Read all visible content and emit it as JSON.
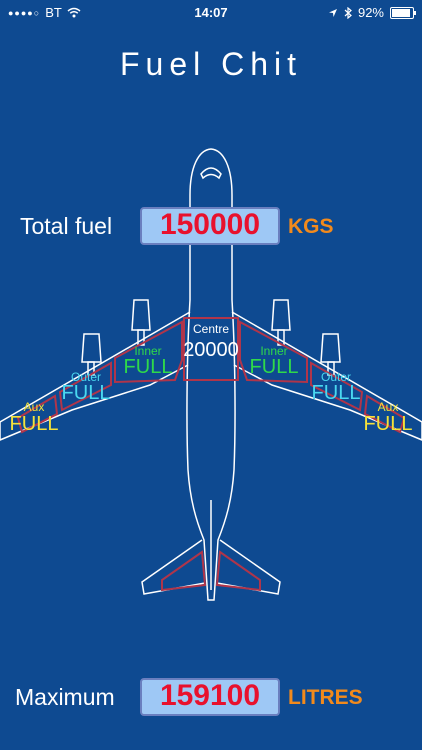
{
  "status": {
    "carrier": "BT",
    "time": "14:07",
    "battery": "92%"
  },
  "title": "Fuel Chit",
  "total": {
    "label": "Total fuel",
    "value": "150000",
    "unit": "KGS"
  },
  "maximum": {
    "label": "Maximum",
    "value": "159100",
    "unit": "LITRES"
  },
  "tanks": {
    "centre": {
      "label": "Centre",
      "value": "20000"
    },
    "inner_left": {
      "label": "Inner",
      "value": "FULL"
    },
    "inner_right": {
      "label": "Inner",
      "value": "FULL"
    },
    "outer_left": {
      "label": "Outer",
      "value": "FULL"
    },
    "outer_right": {
      "label": "Outer",
      "value": "FULL"
    },
    "aux_left": {
      "label": "Aux",
      "value": "FULL"
    },
    "aux_right": {
      "label": "Aux",
      "value": "FULL"
    }
  },
  "colors": {
    "background": "#0e4a91",
    "tank_outline": "#b0354a",
    "inner": "#2fd94a",
    "outer": "#4ad8f0",
    "aux": "#f4e23a",
    "unit": "#f28a1c",
    "value": "#e8112d"
  }
}
